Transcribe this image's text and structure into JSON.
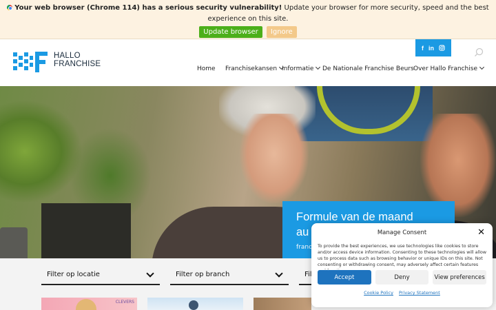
{
  "banner": {
    "warning": "Your web browser (Chrome 114) has a serious security vulnerability!",
    "message": " Update your browser for more security, speed and the best experience on this site.",
    "update_label": "Update browser",
    "ignore_label": "Ignore",
    "icon": "chrome-icon"
  },
  "header": {
    "logo_line1": "HALLO",
    "logo_line2": "FRANCHISE",
    "social": [
      "f",
      "in",
      "ig"
    ],
    "search_icon": "search-icon"
  },
  "nav": {
    "items": [
      {
        "label": "Home",
        "dropdown": false
      },
      {
        "label": "Franchisekansen",
        "dropdown": true
      },
      {
        "label": "Informatie",
        "dropdown": true
      },
      {
        "label": "De Nationale Franchise Beurs",
        "dropdown": false
      },
      {
        "label": "Over Hallo Franchise",
        "dropdown": true
      }
    ]
  },
  "hero": {
    "formula_title_line1": "Formule van de maand",
    "formula_title_line2": "au",
    "formula_sub": "franch"
  },
  "filters": {
    "location": "Filter op locatie",
    "branch": "Filter op branch",
    "third": "Fil"
  },
  "cards": {
    "badge": "CLEVERS"
  },
  "consent": {
    "title": "Manage Consent",
    "body": "To provide the best experiences, we use technologies like cookies to store and/or access device information. Consenting to these technologies will allow us to process data such as browsing behavior or unique IDs on this site. Not consenting or withdrawing consent, may adversely affect certain features and functions.",
    "accept_label": "Accept",
    "deny_label": "Deny",
    "preferences_label": "View preferences",
    "cookie_policy": "Cookie Policy",
    "privacy_statement": "Privacy Statement"
  },
  "colors": {
    "brand_blue": "#1b9ae3",
    "update_green": "#4caf1a",
    "ignore_orange": "#f3c98a",
    "accept_blue": "#1e73be",
    "banner_bg": "#fdf2e1"
  }
}
